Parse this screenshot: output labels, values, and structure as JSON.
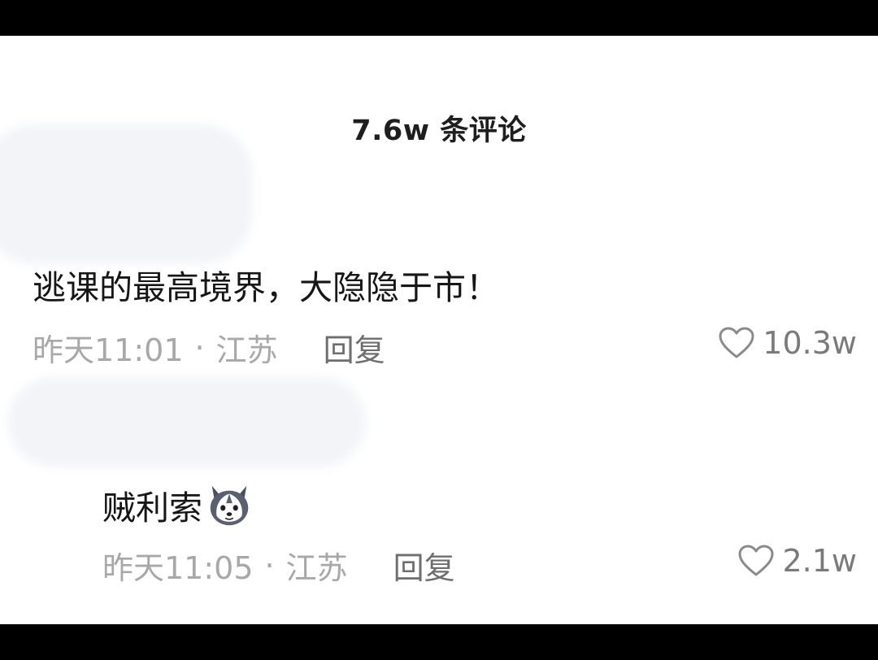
{
  "header": {
    "title": "7.6w 条评论"
  },
  "comments": [
    {
      "text": "逃课的最高境界，大隐隐于市！",
      "time": "昨天11:01",
      "separator": "·",
      "location": "江苏",
      "reply_label": "回复",
      "likes": "10.3w"
    },
    {
      "text": "贼利索",
      "emoji": "husky-dog-emoji",
      "time": "昨天11:05",
      "separator": "·",
      "location": "江苏",
      "reply_label": "回复",
      "likes": "2.1w"
    }
  ]
}
